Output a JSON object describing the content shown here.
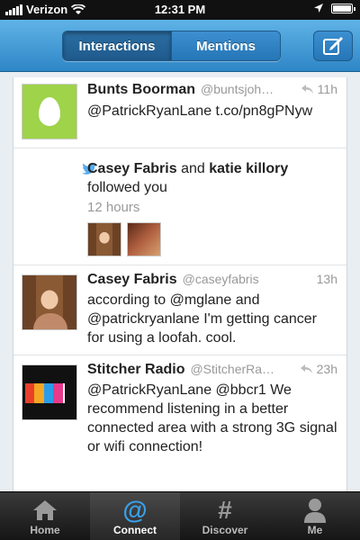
{
  "status_bar": {
    "carrier": "Verizon",
    "time": "12:31 PM"
  },
  "nav": {
    "tabs": [
      {
        "label": "Interactions",
        "active": true
      },
      {
        "label": "Mentions",
        "active": false
      }
    ],
    "compose_icon": "compose-icon"
  },
  "feed": {
    "tweet1": {
      "name": "Bunts Boorman",
      "handle": "@buntsjoh…",
      "time": "11h",
      "text": "@PatrickRyanLane t.co/pn8gPNyw"
    },
    "follow": {
      "name1": "Casey Fabris",
      "connector": "and",
      "name2": "katie killory",
      "action": "followed you",
      "time": "12 hours"
    },
    "tweet2": {
      "name": "Casey Fabris",
      "handle": "@caseyfabris",
      "time": "13h",
      "text": "according to @mglane and @patrickryanlane I'm getting cancer for using a loofah. cool."
    },
    "tweet3": {
      "name": "Stitcher Radio",
      "handle": "@StitcherRa…",
      "time": "23h",
      "text": "@PatrickRyanLane @bbcr1 We recommend listening in a better connected area with a strong 3G signal or wifi connection!"
    }
  },
  "tabbar": {
    "items": [
      {
        "label": "Home"
      },
      {
        "label": "Connect"
      },
      {
        "label": "Discover"
      },
      {
        "label": "Me"
      }
    ],
    "selected": "Connect"
  },
  "colors": {
    "accent": "#2f86c6",
    "egg": "#9ed34a",
    "connect": "#3aa0e8"
  }
}
